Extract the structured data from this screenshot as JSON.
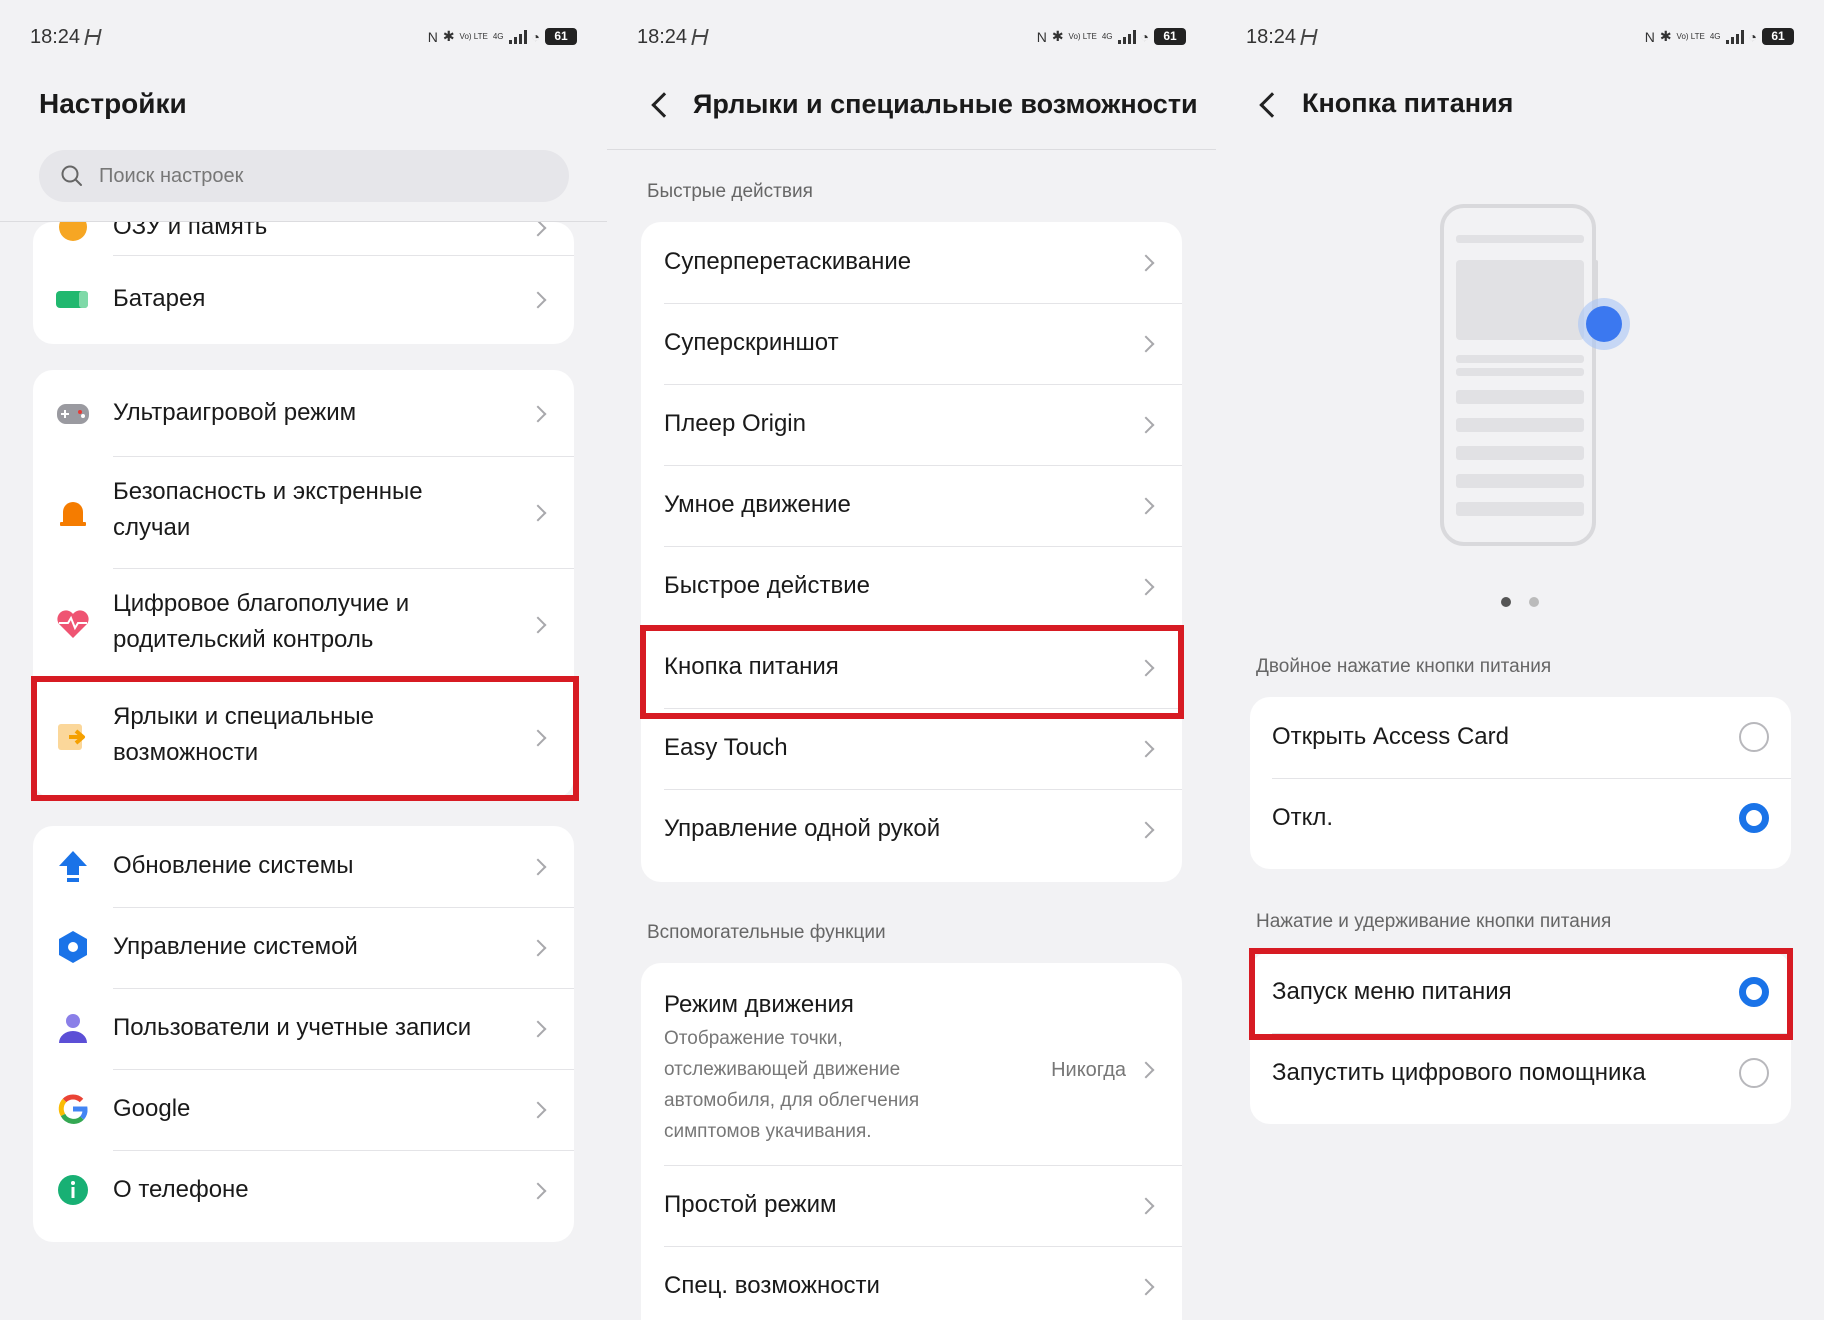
{
  "status": {
    "time": "18:24",
    "battery": "61",
    "volte": "Vo) LTE",
    "net": "4G"
  },
  "panel1": {
    "title": "Настройки",
    "search_placeholder": "Поиск настроек",
    "partial_item": "ОЗУ и память",
    "group1": [
      {
        "label": "Батарея",
        "icon": "battery-icon"
      }
    ],
    "group2": [
      {
        "label": "Ультраигровой режим",
        "icon": "gamepad-icon"
      },
      {
        "label1": "Безопасность и экстренные",
        "label2": "случаи",
        "icon": "alarm-icon"
      },
      {
        "label1": "Цифровое благополучие и",
        "label2": "родительский контроль",
        "icon": "heart-icon"
      },
      {
        "label1": "Ярлыки и специальные",
        "label2": "возможности",
        "icon": "shortcut-icon"
      }
    ],
    "group3": [
      {
        "label": "Обновление системы",
        "icon": "update-arrow-icon"
      },
      {
        "label": "Управление системой",
        "icon": "hexagon-icon"
      },
      {
        "label": "Пользователи и учетные записи",
        "icon": "user-icon"
      },
      {
        "label": "Google",
        "icon": "google-icon"
      },
      {
        "label": "О телефоне",
        "icon": "info-icon"
      }
    ]
  },
  "panel2": {
    "title": "Ярлыки и специальные возможности",
    "section1": "Быстрые действия",
    "items1": [
      "Суперперетаскивание",
      "Суперскриншот",
      "Плеер Origin",
      "Умное движение",
      "Быстрое действие",
      "Кнопка питания",
      "Easy Touch",
      "Управление одной рукой"
    ],
    "section2": "Вспомогательные функции",
    "motion": {
      "label": "Режим движения",
      "desc": [
        "Отображение точки,",
        "отслеживающей движение",
        "автомобиля, для облегчения",
        "симптомов укачивания."
      ],
      "value": "Никогда"
    },
    "items2": [
      "Простой режим",
      "Спец. возможности"
    ]
  },
  "panel3": {
    "title": "Кнопка питания",
    "section1": "Двойное нажатие кнопки питания",
    "options1": [
      {
        "label": "Открыть Access Card",
        "selected": false
      },
      {
        "label": "Откл.",
        "selected": true
      }
    ],
    "section2": "Нажатие и удерживание кнопки питания",
    "options2": [
      {
        "label": "Запуск меню питания",
        "selected": true
      },
      {
        "label": "Запустить цифрового помощника",
        "selected": false
      }
    ]
  },
  "colors": {
    "highlight": "#d71b23",
    "accent": "#1a73e8",
    "background": "#f2f2f4"
  }
}
